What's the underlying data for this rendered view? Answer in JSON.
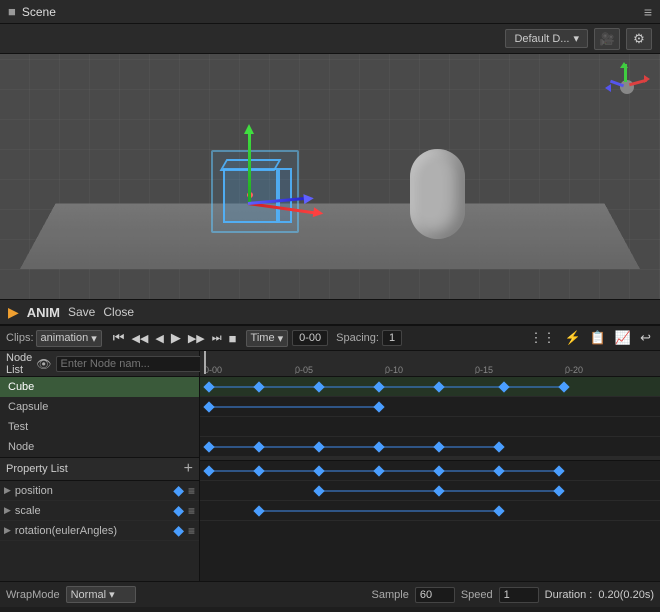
{
  "titlebar": {
    "scene_label": "Scene",
    "hamburger": "≡"
  },
  "toolbar": {
    "default_dropdown": "Default D...",
    "chevron": "▾",
    "camera_icon": "📷",
    "settings_icon": "⚙"
  },
  "anim_header": {
    "icon": "▶",
    "label": "ANIM",
    "save": "Save",
    "close": "Close"
  },
  "animation_bar": {
    "clips_label": "Clips:",
    "animation_btn": "animation",
    "skip_start": "⏮",
    "prev_frame": "⏪",
    "play_rev": "◀",
    "play": "▶",
    "next_frame": "⏩",
    "skip_end": "⏭",
    "stop": "■",
    "time_label": "Time",
    "time_value": "0-00",
    "spacing_label": "Spacing:",
    "spacing_value": "1",
    "icons_right": "⋮⋮ ⚡ 📋 🔧 ↩"
  },
  "node_list": {
    "label": "Node List",
    "eye": "👁",
    "placeholder": "Enter Node nam...",
    "nodes": [
      {
        "name": "Cube",
        "active": true
      },
      {
        "name": "Capsule",
        "active": false
      },
      {
        "name": "Test",
        "active": false
      },
      {
        "name": "Node",
        "active": false
      }
    ]
  },
  "property_list": {
    "label": "Property List",
    "plus": "+",
    "props": [
      {
        "name": "position"
      },
      {
        "name": "scale"
      },
      {
        "name": "rotation(eulerAngles)"
      }
    ]
  },
  "timeline": {
    "ruler_marks": [
      "0-00",
      "0-05",
      "0-10",
      "0-15",
      "0-20"
    ],
    "ruler_positions": [
      4,
      95,
      185,
      275,
      365
    ]
  },
  "bottom_bar": {
    "wrap_mode_label": "WrapMode",
    "wrap_mode_value": "Normal",
    "sample_label": "Sample",
    "sample_value": "60",
    "speed_label": "Speed",
    "speed_value": "1",
    "duration_label": "Duration :",
    "duration_value": "0.20(0.20s)"
  }
}
